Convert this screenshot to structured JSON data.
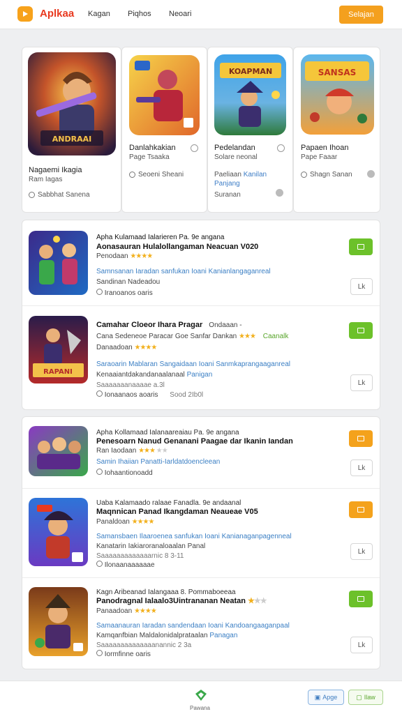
{
  "header": {
    "logo_text": "Aplkaa",
    "nav": [
      "Kagan",
      "Piqhos",
      "Neoari"
    ],
    "cta": "Selajan"
  },
  "featured": [
    {
      "title": "Nagaemi Ikagia",
      "sub": "Ram Iagas",
      "meta": "Sabbhat Sanena"
    },
    {
      "title": "Danlahkakian",
      "sub": "Page Tsaaka",
      "meta": "Seoeni Sheani"
    },
    {
      "title": "Pedelandan",
      "sub": "Solare neonal",
      "sub2": "Paeliaan",
      "sub2_accent": "Kanilan",
      "sub3": "Panjang",
      "meta": "Suranan"
    },
    {
      "title": "Papaen Ihoan",
      "sub": "Pape Faaar",
      "meta": "Shagn Sanan"
    }
  ],
  "list_group_1": [
    {
      "line1": "Apha Kulamaad Ialarieren Pa. 9e angana",
      "line2": "Aonasauran Hulalollangaman Neacuan V020",
      "line3": "Penodaan",
      "stars": 4,
      "line4": "Samnsanan Iaradan sanfukan Ioani Kanianlangaganreal",
      "line5": "Sandinan Nadeadou",
      "line6": "Iranoanos oaris",
      "sec_label": "Lk"
    },
    {
      "line1": "Camahar Cloeor Ihara Pragar",
      "line1_tail": "Ondaaan -",
      "line2": "Cana Sedeneoe Paracar Goe Sanfar Dankan",
      "line2_tag": "Caanalk",
      "line3": "Danaadoan",
      "stars": 4,
      "line4": "Saraoarin Mablaran Sangaidaan Ioani Sanmkaprangaaganreal",
      "line5": "Kenaaiantdakandanaalanaal",
      "line5_accent": "Panigan",
      "line6": "Saaaaaaanaaaae a.3l",
      "line7": "Ionaanaos aoaris",
      "line7_tail": "Sood 2Ib0l",
      "sec_label": "Lk"
    }
  ],
  "list_group_2": [
    {
      "line1": "Apha Kollamaad Ialanaareaiau Pa. 9e angana",
      "line2": "Penesoarn Nanud Genanani Paagae dar Ikanin Iandan",
      "line3": "Ran Iaodaan",
      "stars": 3,
      "line4": "Samin Ihaiian Panatti-Iarldatdoencleean",
      "line5": "Iohaantionoadd",
      "sec_label": "Lk"
    },
    {
      "line1": "Uaba Kalamaado ralaae Fanadla. 9e andaanal",
      "line2": "Maqnnican Panad Ikangdaman Neaueae V05",
      "line3": "Panaldoan",
      "stars": 4,
      "line4": "Samansbaen Ilaaroenea sanfukan Ioani Kanianaganpagenneal",
      "line5": "Kanatarin Iakiaroranaloaalan Panal",
      "line6": "Saaaaaaaaaaaaarnic 8 3-11",
      "line7": "Ilonaanaaaaaae",
      "sec_label": "Lk"
    },
    {
      "line1": "Kagn Aribeanad Ialangaaa 8. Pommaboeeaa",
      "line2": "Panodragnal Ialaalo3Uintrananan Neatan",
      "line3": "Panaadoan",
      "stars": 4,
      "line4": "Samaanauran Iaradan sandendaan Ioani Kandoangaaganpaal",
      "line5": "Kamqanfbian Maldalonidalprataalan",
      "line5_accent": "Panagan",
      "line6": "Saaaaaaaaaaaaaanannic 2 3a",
      "line7": "Iormfinne oaris",
      "sec_label": "Lk"
    }
  ],
  "footer": {
    "label": "Pawana",
    "btn_blue": "Apge",
    "btn_green": "Ilaw"
  },
  "colors": {
    "brand": "#e8391f",
    "accent_orange": "#f4a01e",
    "accent_green": "#6cc12a",
    "link_blue": "#3b7fc4",
    "star": "#f2b01d"
  }
}
